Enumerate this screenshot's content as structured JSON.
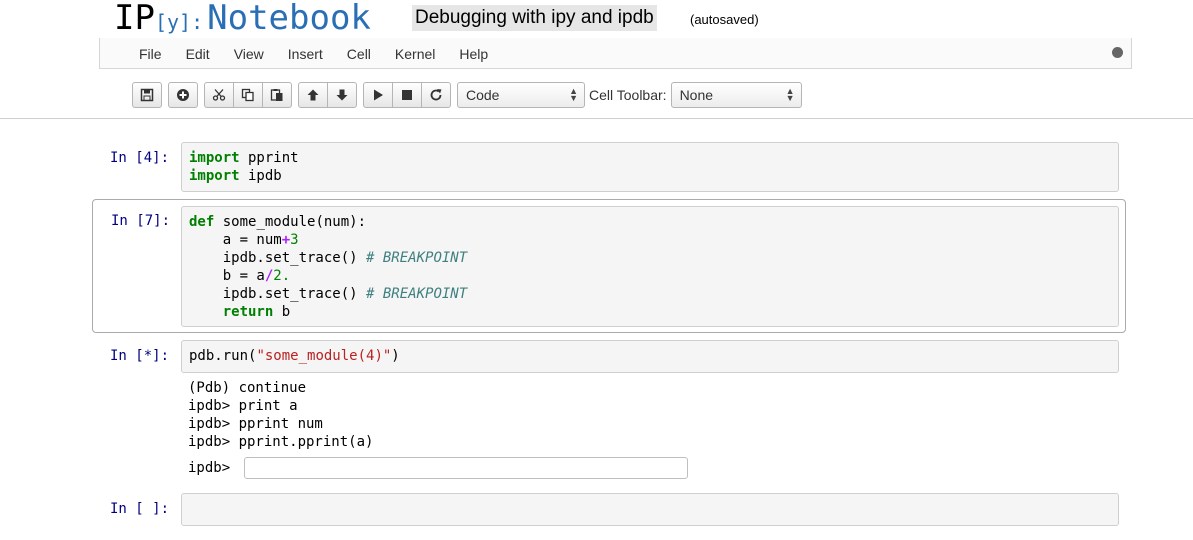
{
  "header": {
    "logo_ip": "IP",
    "logo_y": "[y]:",
    "logo_notebook": "Notebook",
    "notebook_name": "Debugging with ipy and ipdb",
    "autosave_status": "(autosaved)"
  },
  "menu": [
    "File",
    "Edit",
    "View",
    "Insert",
    "Cell",
    "Kernel",
    "Help"
  ],
  "toolbar": {
    "cell_type_selected": "Code",
    "cell_toolbar_label": "Cell Toolbar:",
    "cell_toolbar_selected": "None",
    "icons": [
      "save-icon",
      "plus-icon",
      "cut-icon",
      "copy-icon",
      "paste-icon",
      "arrow-up-icon",
      "arrow-down-icon",
      "play-icon",
      "stop-icon",
      "refresh-icon"
    ]
  },
  "cells": [
    {
      "prompt": "In [4]:"
    },
    {
      "prompt": "In [7]:"
    },
    {
      "prompt": "In [*]:",
      "output": [
        "(Pdb) continue",
        "ipdb> print a",
        "ipdb> pprint num",
        "ipdb> pprint.pprint(a)"
      ],
      "raw_input_prompt": "ipdb>",
      "raw_input_value": ""
    },
    {
      "prompt": "In [ ]:"
    }
  ],
  "code": {
    "c1": {
      "kw": "import",
      "l1": " pprint",
      "l2": " ipdb"
    },
    "c2": {
      "def": "def",
      "sig": " some_module(num):",
      "a_assign": "    a = num",
      "plus": "+",
      "three": "3",
      "trace1": "    ipdb.set_trace() ",
      "cm": "# BREAKPOINT",
      "b_assign": "    b = a",
      "div": "/",
      "two": "2.",
      "trace2": "    ipdb.set_trace() ",
      "ret_indent": "    ",
      "ret": "return",
      "ret_val": " b"
    },
    "c3": {
      "pre": "pdb.run(",
      "str": "\"some_module(4)\"",
      "post": ")"
    }
  },
  "colors": {
    "logo_blue": "#2a6fb5",
    "prompt_blue": "#000080",
    "keyword_green": "#008000",
    "string_red": "#ba2121",
    "comment_teal": "#408080"
  }
}
